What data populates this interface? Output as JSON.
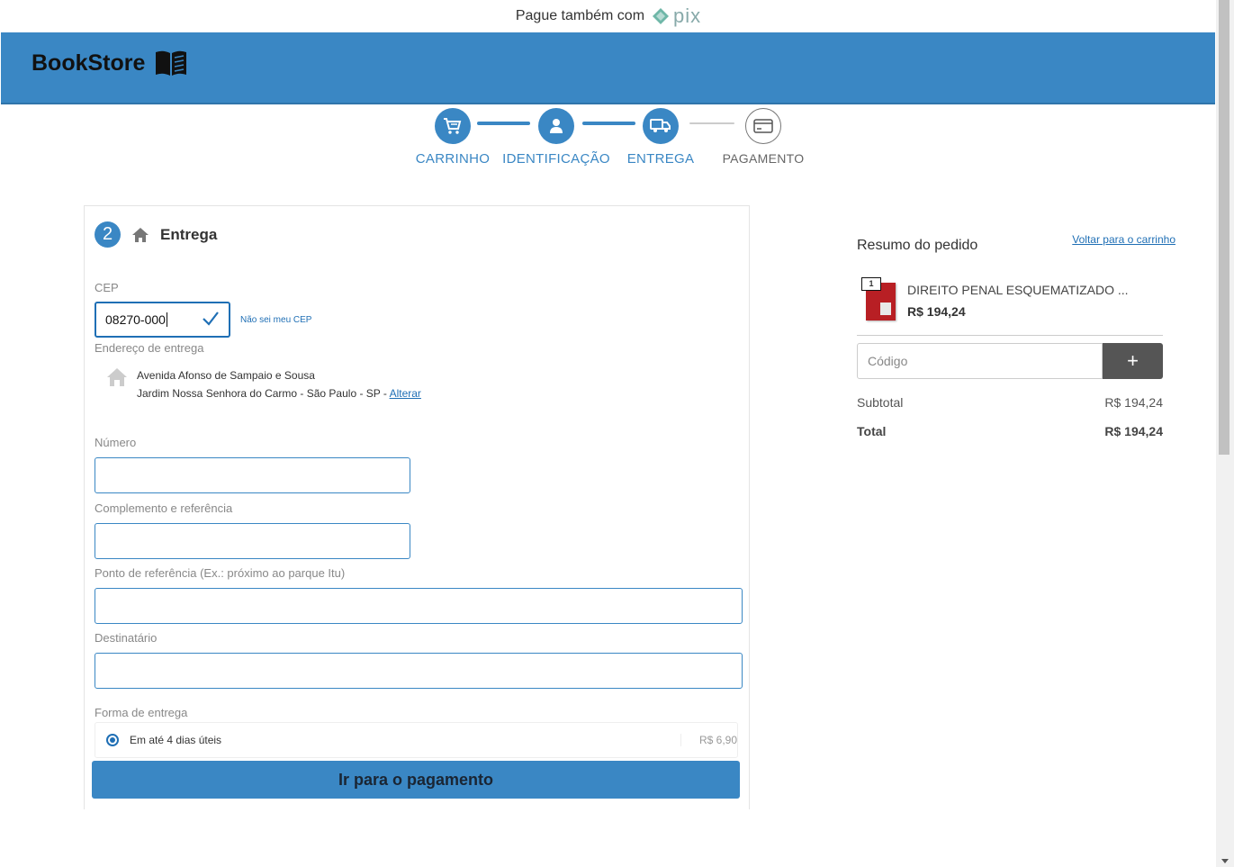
{
  "topbar": {
    "text": "Pague também com",
    "pix": "pix"
  },
  "brand": {
    "name": "BookStore"
  },
  "steps": [
    {
      "label": "CARRINHO",
      "state": "done"
    },
    {
      "label": "IDENTIFICAÇÃO",
      "state": "done"
    },
    {
      "label": "ENTREGA",
      "state": "active"
    },
    {
      "label": "PAGAMENTO",
      "state": "pending"
    }
  ],
  "delivery": {
    "step_number": "2",
    "title": "Entrega",
    "cep_label": "CEP",
    "cep_value": "08270-000",
    "cep_help": "Não sei meu CEP",
    "address_label": "Endereço de entrega",
    "address_line1": "Avenida Afonso de Sampaio e Sousa",
    "address_line2": "Jardim Nossa Senhora do Carmo - São Paulo - SP - ",
    "address_change": "Alterar",
    "numero_label": "Número",
    "complemento_label": "Complemento e referência",
    "referencia_label": "Ponto de referência (Ex.: próximo ao parque Itu)",
    "destinatario_label": "Destinatário",
    "forma_label": "Forma de entrega",
    "shipping_option": "Em até 4 dias úteis",
    "shipping_price": "R$ 6,90",
    "pay_button": "Ir para o pagamento"
  },
  "summary": {
    "title": "Resumo do pedido",
    "back_link": "Voltar para o carrinho",
    "item": {
      "qty": "1",
      "name": "DIREITO PENAL ESQUEMATIZADO ...",
      "price": "R$ 194,24"
    },
    "code_placeholder": "Código",
    "add_button": "+",
    "subtotal_label": "Subtotal",
    "subtotal_value": "R$ 194,24",
    "total_label": "Total",
    "total_value": "R$ 194,24"
  },
  "colors": {
    "brand_blue": "#3a87c4",
    "link_blue": "#1f6fb5"
  }
}
